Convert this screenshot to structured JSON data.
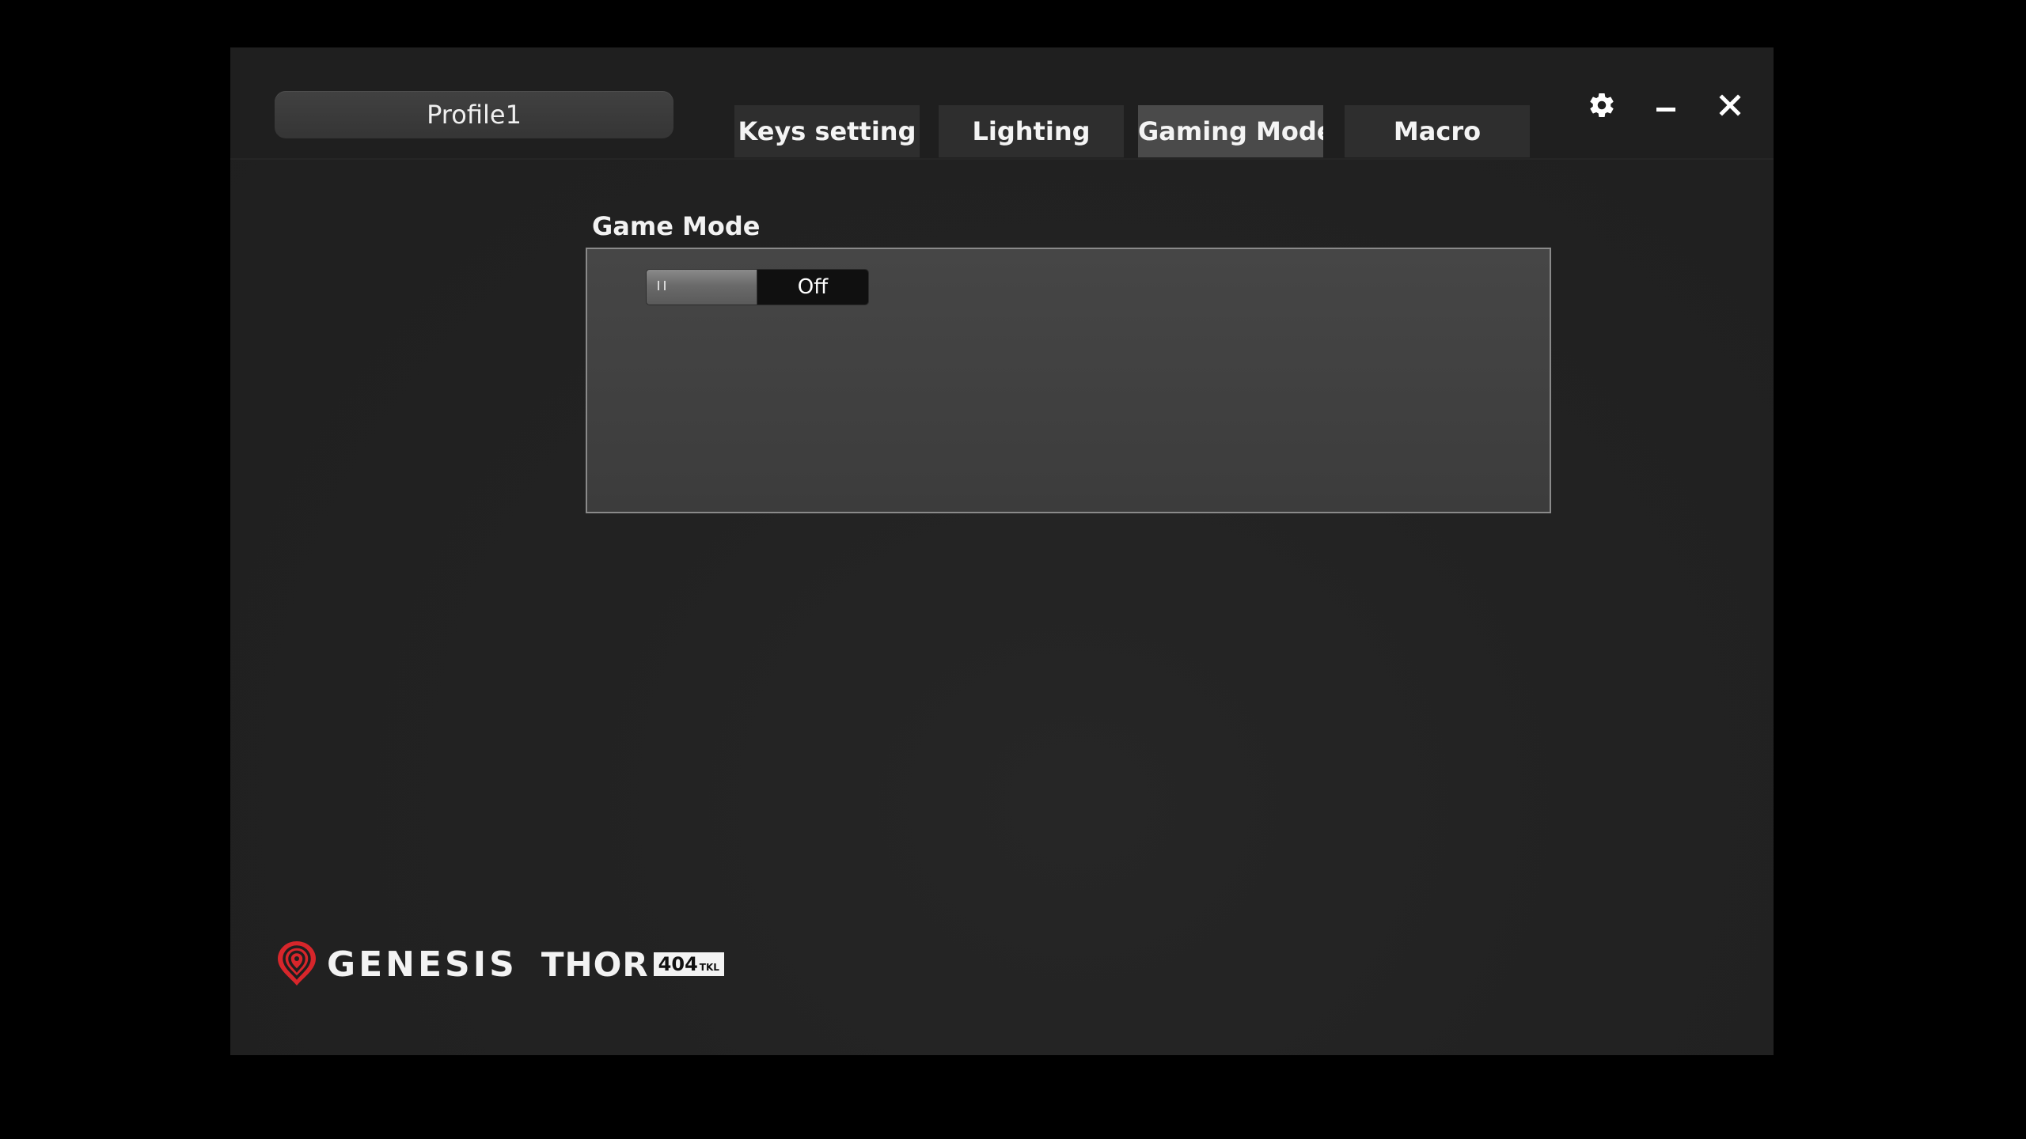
{
  "app": {
    "profile_name": "Profile1"
  },
  "tabs": [
    {
      "label": "Keys setting",
      "active": false
    },
    {
      "label": "Lighting",
      "active": false
    },
    {
      "label": "Gaming Mode",
      "active": true
    },
    {
      "label": "Macro",
      "active": false
    }
  ],
  "window_controls": {
    "settings_icon": "gear-icon",
    "minimize_icon": "minimize-icon",
    "close_icon": "close-icon"
  },
  "game_mode": {
    "title": "Game Mode",
    "toggle_state": "Off"
  },
  "branding": {
    "brand": "GENESIS",
    "model": "THOR",
    "model_number": "404",
    "model_suffix": "TKL",
    "brand_color": "#d7262b"
  }
}
